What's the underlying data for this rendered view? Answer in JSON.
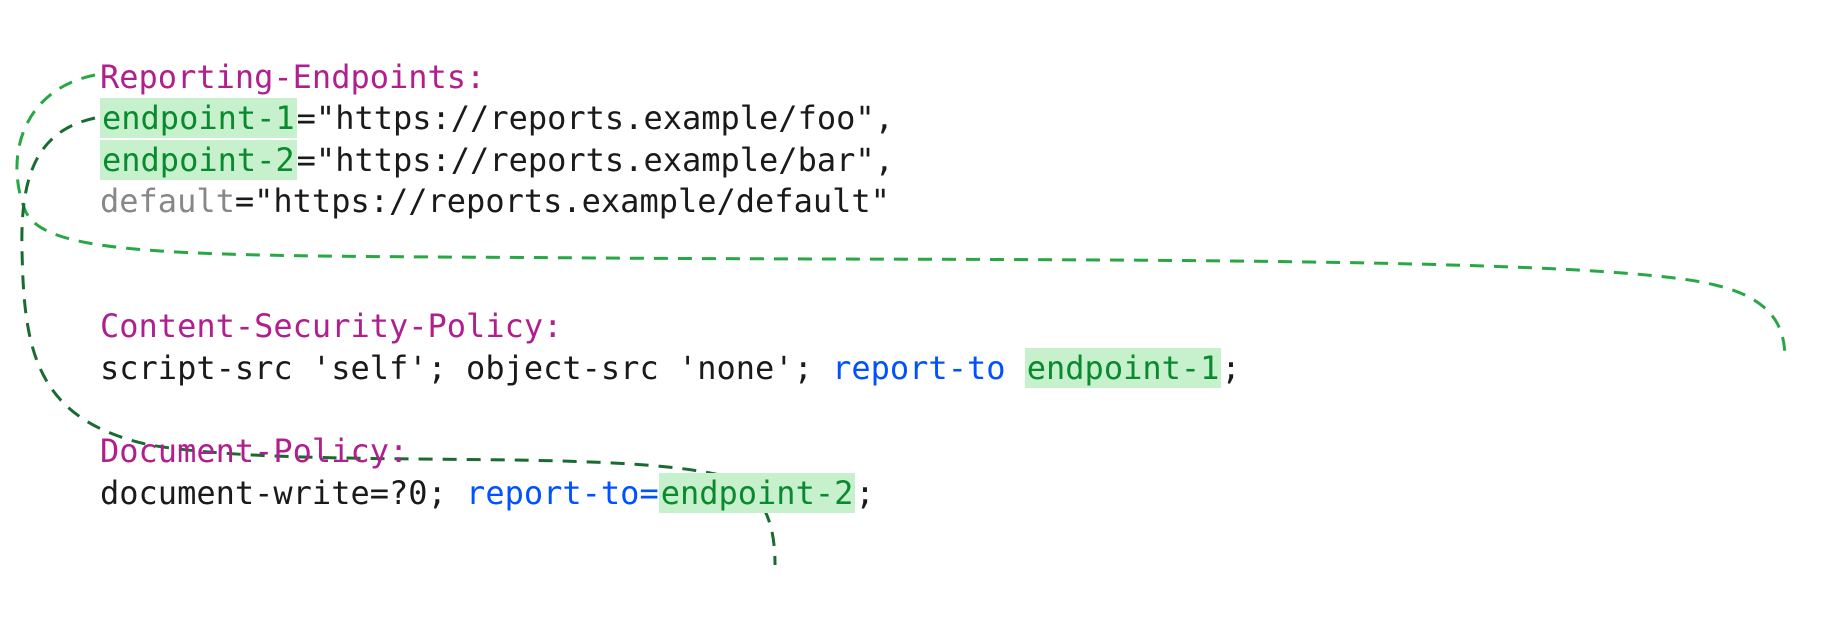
{
  "headers": {
    "reporting_endpoints": {
      "name": "Reporting-Endpoints:",
      "endpoint1_key": "endpoint-1",
      "endpoint1_val": "=\"https://reports.example/foo\",",
      "endpoint2_key": "endpoint-2",
      "endpoint2_val": "=\"https://reports.example/bar\",",
      "default_key": "default",
      "default_val": "=\"https://reports.example/default\""
    },
    "csp": {
      "name": "Content-Security-Policy:",
      "policy_pre": "script-src 'self'; object-src 'none'; ",
      "report_to": "report-to",
      "space": " ",
      "endpoint_ref": "endpoint-1",
      "tail": ";"
    },
    "document_policy": {
      "name": "Document-Policy:",
      "policy_pre": "document-write=?0; ",
      "report_to": "report-to=",
      "endpoint_ref": "endpoint-2",
      "tail": ";"
    }
  }
}
